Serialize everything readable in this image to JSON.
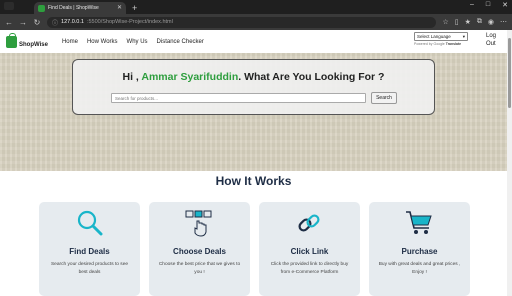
{
  "browser": {
    "tab_title": "Find Deals | ShopWise",
    "new_tab": "+",
    "url_host": "127.0.0.1",
    "url_path": ":5500/ShopWise-Project/index.html"
  },
  "nav": {
    "logo": "ShopWise",
    "links": [
      "Home",
      "How Works",
      "Why Us",
      "Distance Checker"
    ],
    "language_select": "Select Language",
    "powered_by": "Powered by",
    "google": "Google",
    "translate": "Translate",
    "logout": "Log Out"
  },
  "hero": {
    "greeting_prefix": "Hi , ",
    "user_name": "Ammar Syarifuddin",
    "greeting_suffix": ". What Are You Looking For ?",
    "search_placeholder": "Search for products...",
    "search_button": "Search"
  },
  "how_it_works": {
    "title": "How It Works",
    "cards": [
      {
        "icon": "magnifier-icon",
        "title": "Find Deals",
        "desc": "Search your desired products to see best deals"
      },
      {
        "icon": "hand-choose-icon",
        "title": "Choose Deals",
        "desc": "Choose the best price that we gives to you !"
      },
      {
        "icon": "link-icon",
        "title": "Click Link",
        "desc": "Click the provided link to directly buy from e-Commerce Platform"
      },
      {
        "icon": "cart-icon",
        "title": "Purchase",
        "desc": "Buy with great deals and great prices , Enjoy !"
      }
    ]
  },
  "colors": {
    "brand_green": "#2e9e3e",
    "icon_teal": "#19b5c9",
    "title_navy": "#1e2d45"
  }
}
